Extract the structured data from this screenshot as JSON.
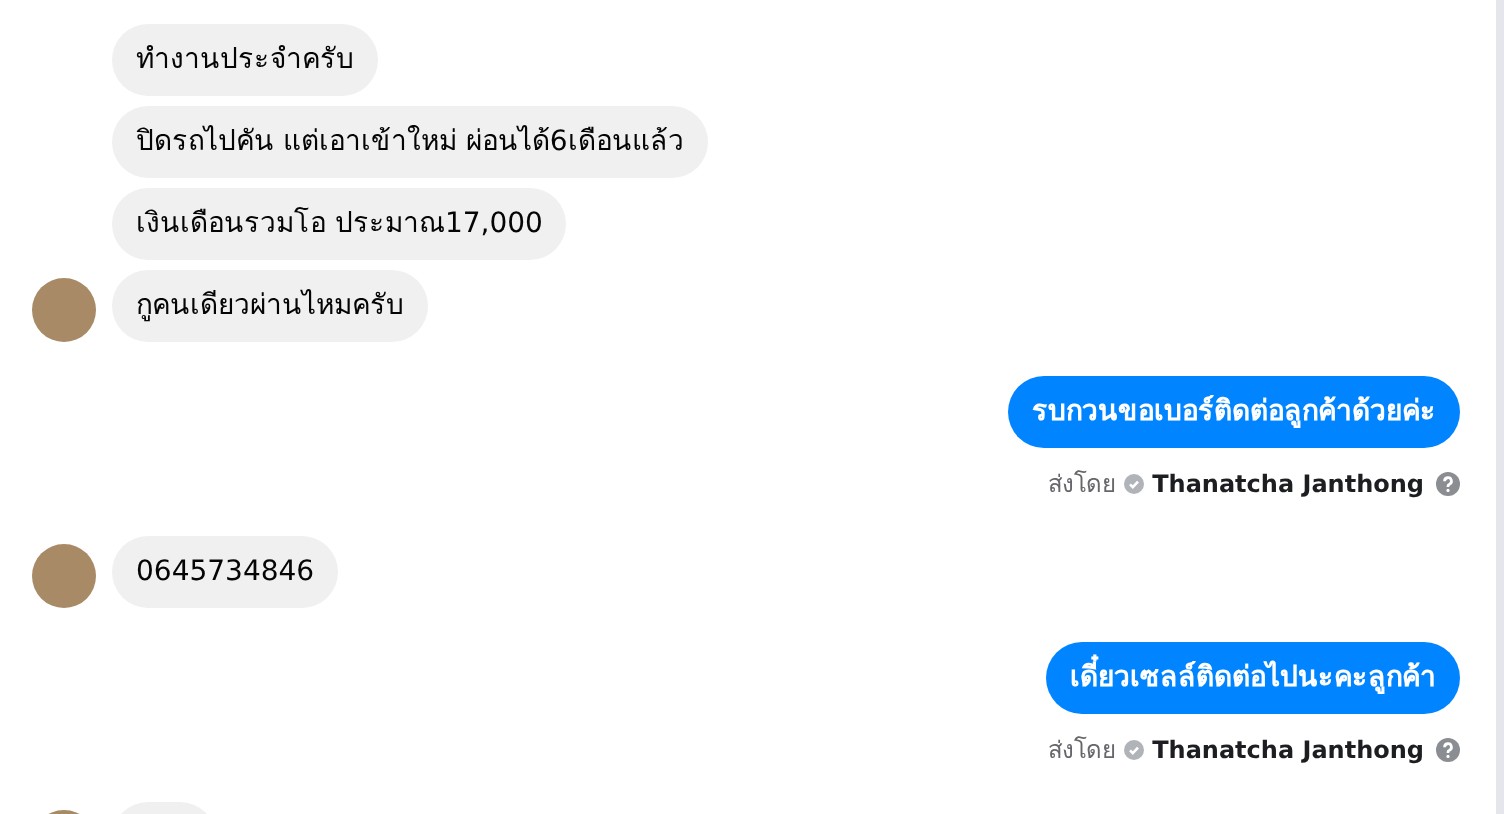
{
  "groups": [
    {
      "kind": "incoming",
      "messages": [
        {
          "text": "ทำงานประจำครับ"
        },
        {
          "text": "ปิดรถไปคัน แต่เอาเข้าใหม่ ผ่อนได้6เดือนแล้ว"
        },
        {
          "text": "เงินเดือนรวมโอ ประมาณ17,000"
        },
        {
          "text": "กูคนเดียวผ่านไหมครับ"
        }
      ]
    },
    {
      "kind": "outgoing",
      "messages": [
        {
          "text": "รบกวนขอเบอร์ติดต่อลูกค้าด้วยค่ะ"
        }
      ],
      "sent_by_label": "ส่งโดย",
      "sender": "Thanatcha Janthong"
    },
    {
      "kind": "incoming",
      "messages": [
        {
          "text": "0645734846"
        }
      ]
    },
    {
      "kind": "outgoing",
      "messages": [
        {
          "text": "เดี๋ยวเซลล์ติดต่อไปนะคะลูกค้า"
        }
      ],
      "sent_by_label": "ส่งโดย",
      "sender": "Thanatcha Janthong"
    },
    {
      "kind": "incoming",
      "partial": true
    }
  ]
}
